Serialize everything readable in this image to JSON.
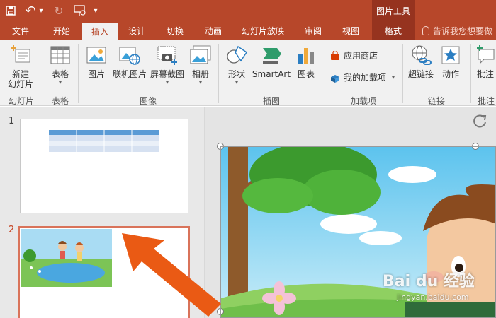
{
  "qat": {
    "undo_arrow": "↶",
    "redo_arrow": "↻",
    "dropdown_caret": "▾",
    "customize_caret": "▾"
  },
  "context_tools": "图片工具",
  "tabs": [
    "文件",
    "开始",
    "插入",
    "设计",
    "切换",
    "动画",
    "幻灯片放映",
    "审阅",
    "视图",
    "格式"
  ],
  "tell_me": "告诉我您想要做",
  "ribbon": {
    "new_slide": "新建\n幻灯片",
    "table": "表格",
    "picture": "图片",
    "online_picture": "联机图片",
    "screenshot": "屏幕截图",
    "album": "相册",
    "shapes": "形状",
    "smartart": "SmartArt",
    "chart": "图表",
    "store": "应用商店",
    "my_addins": "我的加载项",
    "hyperlink": "超链接",
    "action": "动作",
    "comment": "批注"
  },
  "groups": [
    "幻灯片",
    "表格",
    "图像",
    "插图",
    "加载项",
    "链接",
    "批注"
  ],
  "slides": [
    {
      "number": "1"
    },
    {
      "number": "2"
    }
  ],
  "watermark": {
    "text": "Bai du 经验",
    "sub": "jingyan.baidu.com"
  },
  "colors": {
    "accent": "#b7472a",
    "context": "#96331f",
    "arrow": "#ea5a14",
    "selection": "#d9735a"
  }
}
